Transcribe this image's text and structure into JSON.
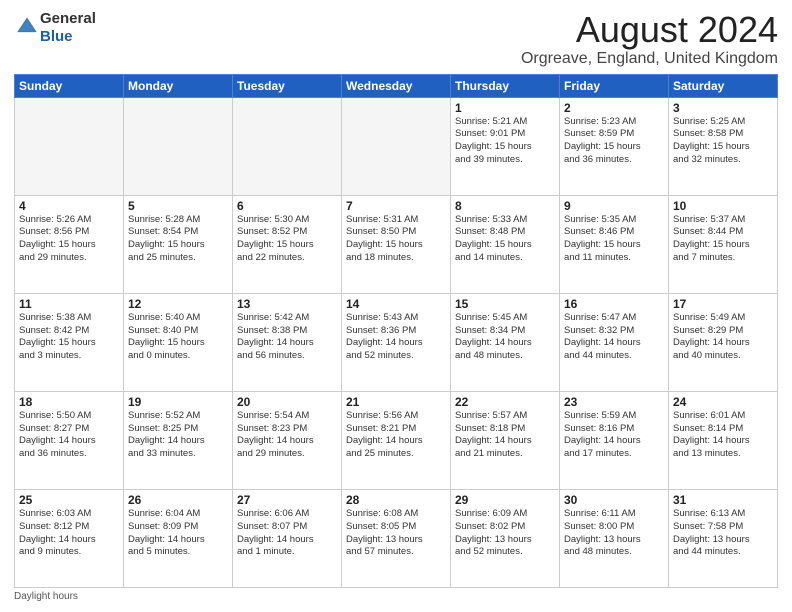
{
  "header": {
    "logo_general": "General",
    "logo_blue": "Blue",
    "title": "August 2024",
    "location": "Orgreave, England, United Kingdom"
  },
  "weekdays": [
    "Sunday",
    "Monday",
    "Tuesday",
    "Wednesday",
    "Thursday",
    "Friday",
    "Saturday"
  ],
  "weeks": [
    [
      {
        "day": "",
        "info": "",
        "empty": true
      },
      {
        "day": "",
        "info": "",
        "empty": true
      },
      {
        "day": "",
        "info": "",
        "empty": true
      },
      {
        "day": "",
        "info": "",
        "empty": true
      },
      {
        "day": "1",
        "info": "Sunrise: 5:21 AM\nSunset: 9:01 PM\nDaylight: 15 hours\nand 39 minutes."
      },
      {
        "day": "2",
        "info": "Sunrise: 5:23 AM\nSunset: 8:59 PM\nDaylight: 15 hours\nand 36 minutes."
      },
      {
        "day": "3",
        "info": "Sunrise: 5:25 AM\nSunset: 8:58 PM\nDaylight: 15 hours\nand 32 minutes."
      }
    ],
    [
      {
        "day": "4",
        "info": "Sunrise: 5:26 AM\nSunset: 8:56 PM\nDaylight: 15 hours\nand 29 minutes."
      },
      {
        "day": "5",
        "info": "Sunrise: 5:28 AM\nSunset: 8:54 PM\nDaylight: 15 hours\nand 25 minutes."
      },
      {
        "day": "6",
        "info": "Sunrise: 5:30 AM\nSunset: 8:52 PM\nDaylight: 15 hours\nand 22 minutes."
      },
      {
        "day": "7",
        "info": "Sunrise: 5:31 AM\nSunset: 8:50 PM\nDaylight: 15 hours\nand 18 minutes."
      },
      {
        "day": "8",
        "info": "Sunrise: 5:33 AM\nSunset: 8:48 PM\nDaylight: 15 hours\nand 14 minutes."
      },
      {
        "day": "9",
        "info": "Sunrise: 5:35 AM\nSunset: 8:46 PM\nDaylight: 15 hours\nand 11 minutes."
      },
      {
        "day": "10",
        "info": "Sunrise: 5:37 AM\nSunset: 8:44 PM\nDaylight: 15 hours\nand 7 minutes."
      }
    ],
    [
      {
        "day": "11",
        "info": "Sunrise: 5:38 AM\nSunset: 8:42 PM\nDaylight: 15 hours\nand 3 minutes."
      },
      {
        "day": "12",
        "info": "Sunrise: 5:40 AM\nSunset: 8:40 PM\nDaylight: 15 hours\nand 0 minutes."
      },
      {
        "day": "13",
        "info": "Sunrise: 5:42 AM\nSunset: 8:38 PM\nDaylight: 14 hours\nand 56 minutes."
      },
      {
        "day": "14",
        "info": "Sunrise: 5:43 AM\nSunset: 8:36 PM\nDaylight: 14 hours\nand 52 minutes."
      },
      {
        "day": "15",
        "info": "Sunrise: 5:45 AM\nSunset: 8:34 PM\nDaylight: 14 hours\nand 48 minutes."
      },
      {
        "day": "16",
        "info": "Sunrise: 5:47 AM\nSunset: 8:32 PM\nDaylight: 14 hours\nand 44 minutes."
      },
      {
        "day": "17",
        "info": "Sunrise: 5:49 AM\nSunset: 8:29 PM\nDaylight: 14 hours\nand 40 minutes."
      }
    ],
    [
      {
        "day": "18",
        "info": "Sunrise: 5:50 AM\nSunset: 8:27 PM\nDaylight: 14 hours\nand 36 minutes."
      },
      {
        "day": "19",
        "info": "Sunrise: 5:52 AM\nSunset: 8:25 PM\nDaylight: 14 hours\nand 33 minutes."
      },
      {
        "day": "20",
        "info": "Sunrise: 5:54 AM\nSunset: 8:23 PM\nDaylight: 14 hours\nand 29 minutes."
      },
      {
        "day": "21",
        "info": "Sunrise: 5:56 AM\nSunset: 8:21 PM\nDaylight: 14 hours\nand 25 minutes."
      },
      {
        "day": "22",
        "info": "Sunrise: 5:57 AM\nSunset: 8:18 PM\nDaylight: 14 hours\nand 21 minutes."
      },
      {
        "day": "23",
        "info": "Sunrise: 5:59 AM\nSunset: 8:16 PM\nDaylight: 14 hours\nand 17 minutes."
      },
      {
        "day": "24",
        "info": "Sunrise: 6:01 AM\nSunset: 8:14 PM\nDaylight: 14 hours\nand 13 minutes."
      }
    ],
    [
      {
        "day": "25",
        "info": "Sunrise: 6:03 AM\nSunset: 8:12 PM\nDaylight: 14 hours\nand 9 minutes."
      },
      {
        "day": "26",
        "info": "Sunrise: 6:04 AM\nSunset: 8:09 PM\nDaylight: 14 hours\nand 5 minutes."
      },
      {
        "day": "27",
        "info": "Sunrise: 6:06 AM\nSunset: 8:07 PM\nDaylight: 14 hours\nand 1 minute."
      },
      {
        "day": "28",
        "info": "Sunrise: 6:08 AM\nSunset: 8:05 PM\nDaylight: 13 hours\nand 57 minutes."
      },
      {
        "day": "29",
        "info": "Sunrise: 6:09 AM\nSunset: 8:02 PM\nDaylight: 13 hours\nand 52 minutes."
      },
      {
        "day": "30",
        "info": "Sunrise: 6:11 AM\nSunset: 8:00 PM\nDaylight: 13 hours\nand 48 minutes."
      },
      {
        "day": "31",
        "info": "Sunrise: 6:13 AM\nSunset: 7:58 PM\nDaylight: 13 hours\nand 44 minutes."
      }
    ]
  ],
  "footer": "Daylight hours"
}
